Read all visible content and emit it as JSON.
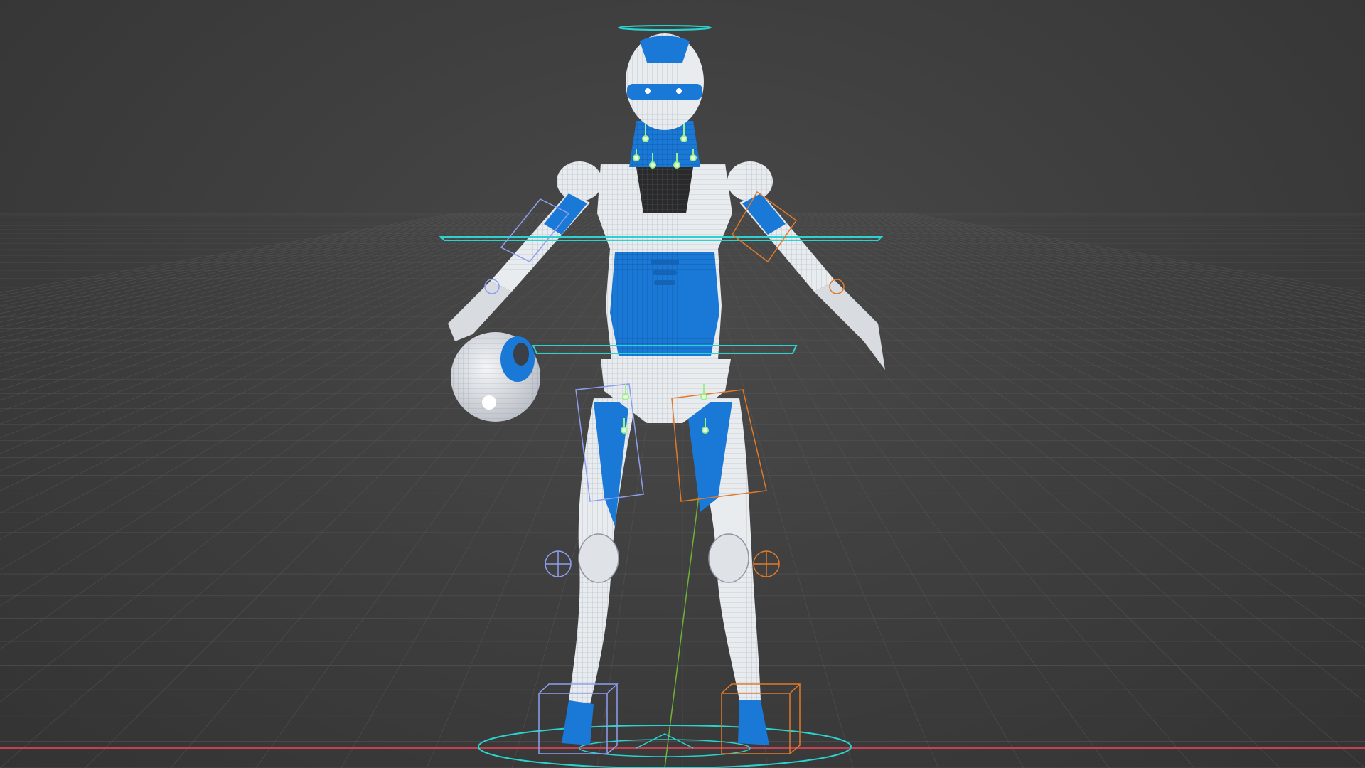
{
  "viewport": {
    "background": "#3f3f3f",
    "grid_color": "#5a5a5a",
    "x_axis_color": "#c4414f",
    "y_axis_color": "#6fb336"
  },
  "model": {
    "armor_blue": "#1a78d6",
    "armor_white": "#e9ecef",
    "wire_color": "#6d7f99"
  },
  "rig": {
    "control_cyan": "#2bd3cf",
    "left_side_color": "#8f9ff0",
    "right_side_color": "#e07a2a",
    "face_control_color": "#9cf08c"
  }
}
